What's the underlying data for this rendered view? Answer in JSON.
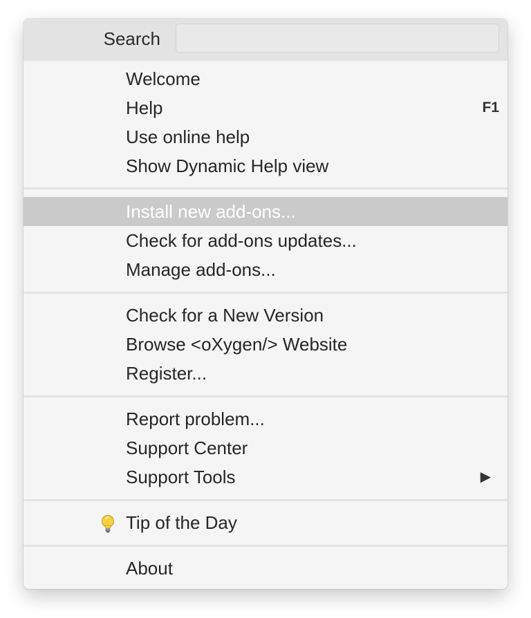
{
  "search": {
    "label": "Search",
    "value": "",
    "placeholder": ""
  },
  "groups": [
    {
      "items": [
        {
          "label": "Welcome"
        },
        {
          "label": "Help",
          "shortcut": "F1"
        },
        {
          "label": "Use online help"
        },
        {
          "label": "Show Dynamic Help view"
        }
      ]
    },
    {
      "items": [
        {
          "label": "Install new add-ons...",
          "highlighted": true
        },
        {
          "label": "Check for add-ons updates..."
        },
        {
          "label": "Manage add-ons..."
        }
      ]
    },
    {
      "items": [
        {
          "label": "Check for a New Version"
        },
        {
          "label": "Browse <oXygen/> Website"
        },
        {
          "label": "Register..."
        }
      ]
    },
    {
      "items": [
        {
          "label": "Report problem..."
        },
        {
          "label": "Support Center"
        },
        {
          "label": "Support Tools",
          "submenu_icon": "triangle-right-icon"
        }
      ]
    },
    {
      "items": [
        {
          "label": "Tip of the Day",
          "icon": "lightbulb-icon"
        }
      ]
    },
    {
      "items": [
        {
          "label": "About"
        }
      ]
    }
  ],
  "colors": {
    "menu_background": "#f5f5f5",
    "search_background": "#e3e3e3",
    "highlight_background": "#cacaca",
    "highlight_text": "#ffffff",
    "separator": "#e4e4e4"
  }
}
